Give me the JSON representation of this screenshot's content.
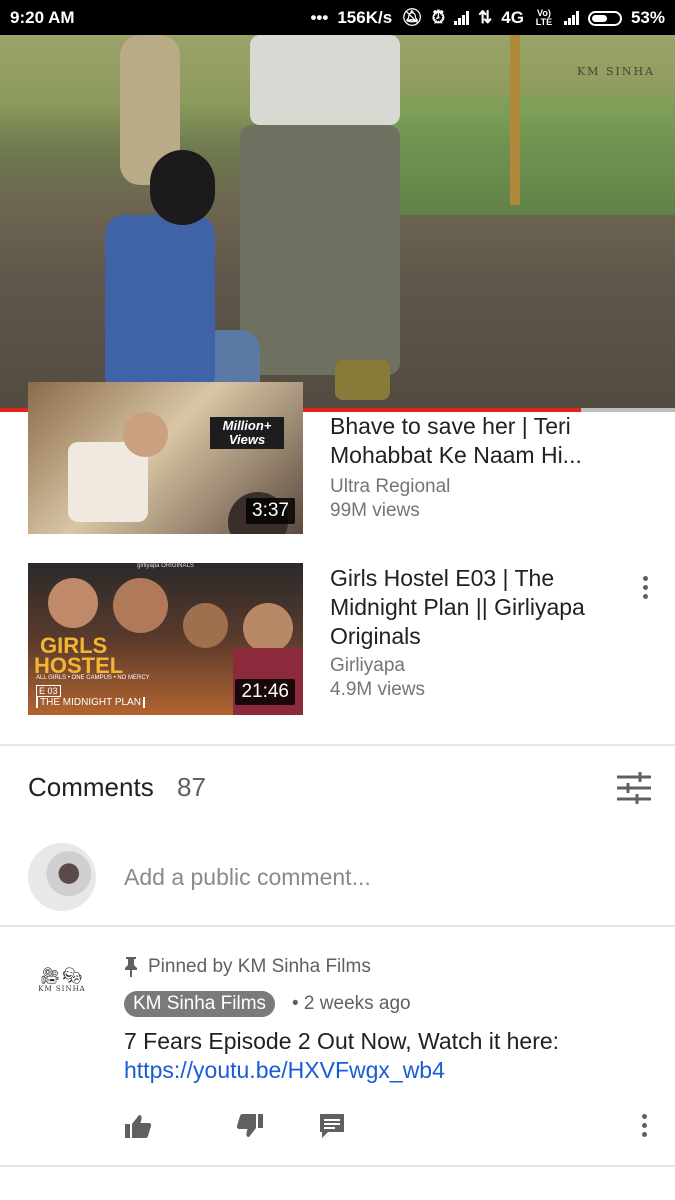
{
  "status_bar": {
    "time": "9:20 AM",
    "dots": "•••",
    "speed": "156K/s",
    "network": "4G",
    "volte": "Vo) LTE",
    "battery": "53%"
  },
  "player": {
    "progress": 0.86,
    "watermark": "KM SINHA"
  },
  "related": [
    {
      "title": "Bhave to save her | Teri Mohabbat Ke Naam Hi...",
      "channel": "Ultra Regional",
      "views": "99M views",
      "duration": "3:37",
      "thumb_badge": "Million+ Views"
    },
    {
      "title": "Girls Hostel E03 | The Midnight Plan || Girliyapa Originals",
      "channel": "Girliyapa",
      "views": "4.9M views",
      "duration": "21:46",
      "thumb_top": "girliyapa ORIGINALS",
      "thumb_show_1": "GIRLS",
      "thumb_show_2": "HOSTEL",
      "thumb_sub": "ALL GIRLS • ONE CAMPUS • NO MERCY",
      "thumb_ep": "E 03",
      "thumb_ep_title": "THE MIDNIGHT PLAN"
    }
  ],
  "comments": {
    "heading": "Comments",
    "count": "87",
    "add_placeholder": "Add a public comment..."
  },
  "pinned_comment": {
    "pinned_by": "Pinned by KM Sinha Films",
    "channel_logo_text": "KM SINHA",
    "author": "KM Sinha Films",
    "age": "• 2 weeks ago",
    "text": "7 Fears Episode 2 Out Now, Watch it here:",
    "link": "https://youtu.be/HXVFwgx_wb4"
  }
}
